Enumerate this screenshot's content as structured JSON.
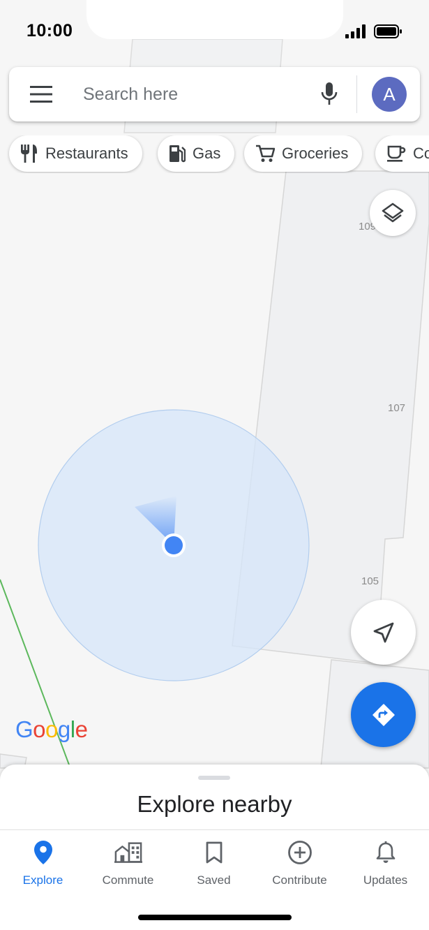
{
  "status_bar": {
    "time": "10:00",
    "icons": [
      "signal-icon",
      "battery-icon"
    ]
  },
  "search": {
    "placeholder": "Search here",
    "value": "",
    "avatar_letter": "A",
    "icons": [
      "menu-icon",
      "microphone-icon"
    ]
  },
  "chips": [
    {
      "label": "Restaurants",
      "icon": "restaurant-icon"
    },
    {
      "label": "Gas",
      "icon": "gas-station-icon"
    },
    {
      "label": "Groceries",
      "icon": "shopping-cart-icon"
    },
    {
      "label": "Co",
      "icon": "coffee-icon"
    }
  ],
  "map": {
    "building_numbers": [
      "109",
      "107",
      "105"
    ],
    "logo_letters": [
      "G",
      "o",
      "o",
      "g",
      "l",
      "e"
    ],
    "logo_colors": [
      "#4285F4",
      "#EA4335",
      "#FBBC05",
      "#4285F4",
      "#34A853",
      "#EA4335"
    ],
    "icons": [
      "layers-icon",
      "location-arrow-icon",
      "directions-icon"
    ]
  },
  "sheet": {
    "title": "Explore nearby"
  },
  "nav": {
    "items": [
      {
        "label": "Explore",
        "icon": "location-pin-icon",
        "active": true
      },
      {
        "label": "Commute",
        "icon": "commute-icon",
        "active": false
      },
      {
        "label": "Saved",
        "icon": "bookmark-icon",
        "active": false
      },
      {
        "label": "Contribute",
        "icon": "add-circle-icon",
        "active": false
      },
      {
        "label": "Updates",
        "icon": "bell-icon",
        "active": false
      }
    ]
  },
  "colors": {
    "accent": "#1a73e8",
    "avatar": "#5c6bc0",
    "location_dot": "#4285f4",
    "accuracy_circle": "#dbe8fa"
  }
}
